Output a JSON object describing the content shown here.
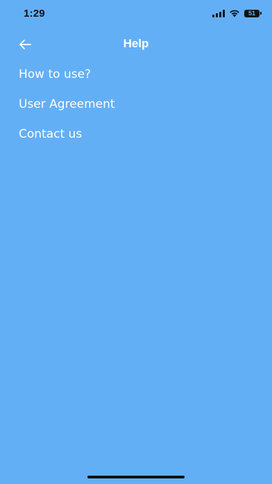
{
  "status_bar": {
    "time": "1:29",
    "battery": "51"
  },
  "header": {
    "title": "Help",
    "back_icon": "arrow-left-icon"
  },
  "menu": {
    "items": [
      {
        "label": "How to use?"
      },
      {
        "label": "User Agreement"
      },
      {
        "label": "Contact us"
      }
    ]
  },
  "colors": {
    "background": "#63aff6",
    "text": "#ffffff",
    "status": "#111111"
  }
}
